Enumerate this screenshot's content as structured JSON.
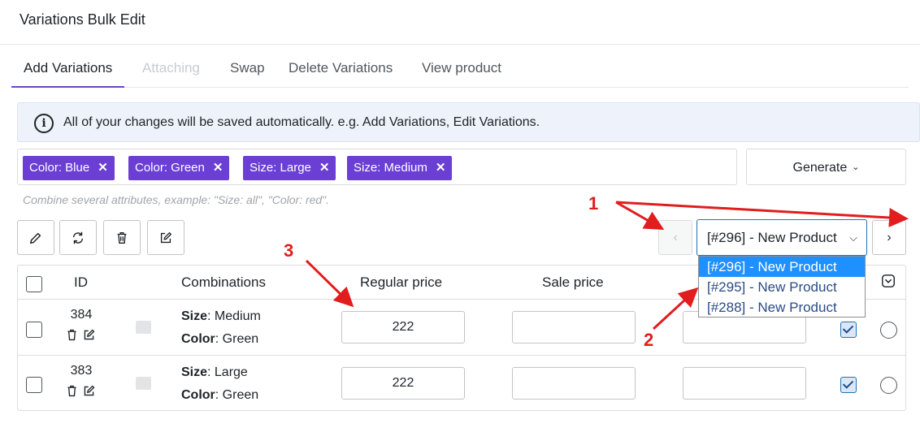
{
  "app": {
    "title": "Variations Bulk Edit"
  },
  "tabs": [
    {
      "label": "Add Variations",
      "state": "active"
    },
    {
      "label": "Attaching",
      "state": "disabled"
    },
    {
      "label": "Swap",
      "state": "normal"
    },
    {
      "label": "Delete Variations",
      "state": "normal"
    },
    {
      "label": "View product",
      "state": "normal"
    }
  ],
  "notice": {
    "icon": "info-icon",
    "text": "All of your changes will be saved automatically. e.g. Add Variations, Edit Variations."
  },
  "attributes": {
    "chips": [
      {
        "label": "Color: Blue"
      },
      {
        "label": "Color: Green"
      },
      {
        "label": "Size: Large"
      },
      {
        "label": "Size: Medium"
      }
    ],
    "remove_glyph": "✕",
    "hint": "Combine several attributes, example: \"Size: all\", \"Color: red\"."
  },
  "generate": {
    "label": "Generate",
    "icon": "chevron-down-icon"
  },
  "toolbar": {
    "buttons": [
      {
        "name": "edit-button",
        "icon": "pencil-icon"
      },
      {
        "name": "refresh-button",
        "icon": "refresh-icon"
      },
      {
        "name": "delete-button",
        "icon": "trash-icon"
      },
      {
        "name": "bulk-edit-button",
        "icon": "edit-square-icon"
      }
    ]
  },
  "product_nav": {
    "prev_glyph": "‹",
    "next_glyph": "›",
    "selected": "[#296] - New Product",
    "options": [
      "[#296] - New Product",
      "[#295] - New Product",
      "[#288] - New Product"
    ]
  },
  "table": {
    "headers": {
      "id": "ID",
      "combinations": "Combinations",
      "regular_price": "Regular price",
      "sale_price": "Sale price"
    },
    "rows": [
      {
        "id": "384",
        "combo": [
          {
            "key": "Size",
            "value": ": Medium"
          },
          {
            "key": "Color",
            "value": ": Green"
          }
        ],
        "regular_price": "222",
        "sale_price": "",
        "extra": "",
        "enabled": true
      },
      {
        "id": "383",
        "combo": [
          {
            "key": "Size",
            "value": ": Large"
          },
          {
            "key": "Color",
            "value": ": Green"
          }
        ],
        "regular_price": "222",
        "sale_price": "",
        "extra": "",
        "enabled": true
      }
    ]
  },
  "annotations": {
    "label_1": "1",
    "label_2": "2",
    "label_3": "3",
    "color": "#e11d1d"
  }
}
